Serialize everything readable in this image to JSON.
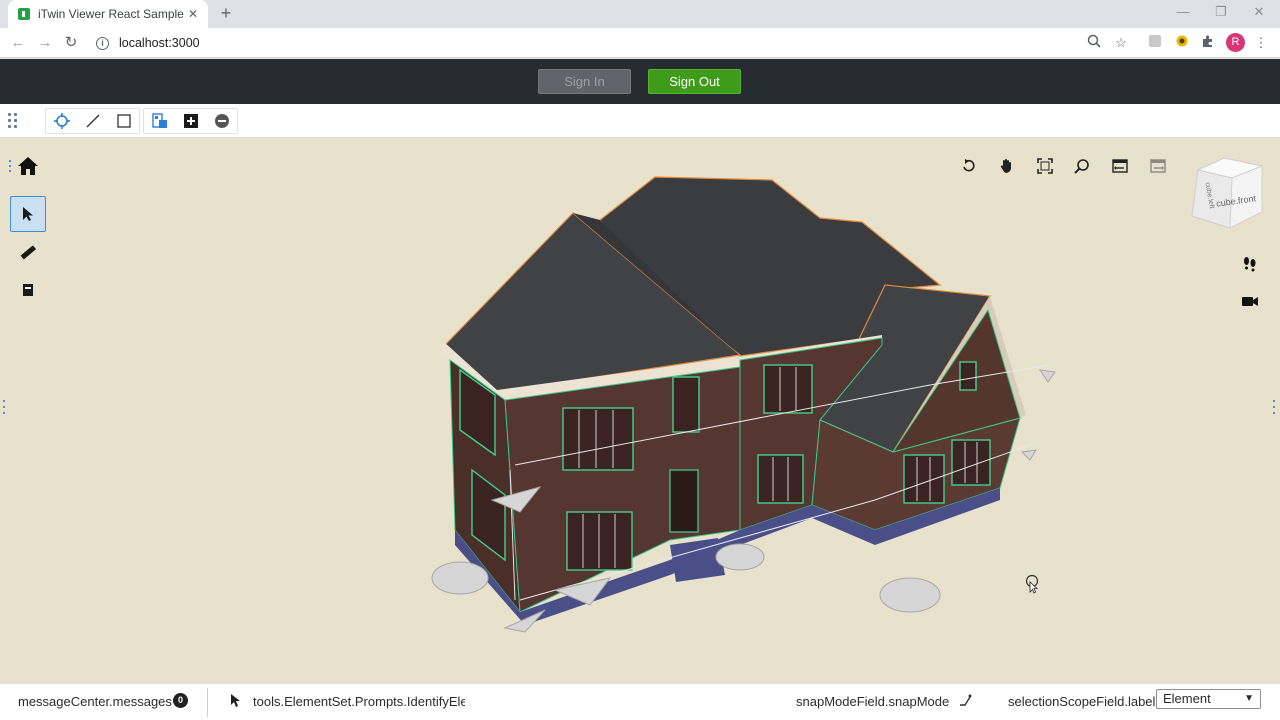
{
  "browser": {
    "tab_title": "iTwin Viewer React Sample",
    "tab_close": "✕",
    "new_tab": "+",
    "url": "localhost:3000",
    "profile_initial": "R",
    "controls": {
      "minimize": "—",
      "restore": "❐",
      "close": "✕"
    }
  },
  "header": {
    "sign_in_label": "Sign In",
    "sign_out_label": "Sign Out",
    "sign_in_color": "#5f656c",
    "sign_out_color": "#3f9c1a"
  },
  "toolbar": {
    "icons": [
      "grip-icon",
      "select-tool-icon",
      "line-icon",
      "rectangle-icon",
      "isolate-icon",
      "add-icon",
      "remove-icon"
    ]
  },
  "viewport": {
    "background": "#e8e2cc",
    "left_tools": [
      "home-icon",
      "select-arrow-icon",
      "measure-icon",
      "section-icon"
    ],
    "nav_tools": [
      "rotate-icon",
      "pan-icon",
      "fit-view-icon",
      "zoom-window-icon",
      "previous-view-icon",
      "next-view-icon"
    ],
    "cube_front_label": "cube.front",
    "cube_left_label": "cube.left",
    "right_tools": [
      "walk-icon",
      "camera-icon"
    ]
  },
  "statusbar": {
    "message_center_label": "messageCenter.messages",
    "message_count": "0",
    "prompt_text": "tools.ElementSet.Prompts.IdentifyEler",
    "snap_mode_label": "snapModeField.snapMode",
    "selection_scope_label": "selectionScopeField.label:",
    "selection_scope_value": "Element"
  }
}
